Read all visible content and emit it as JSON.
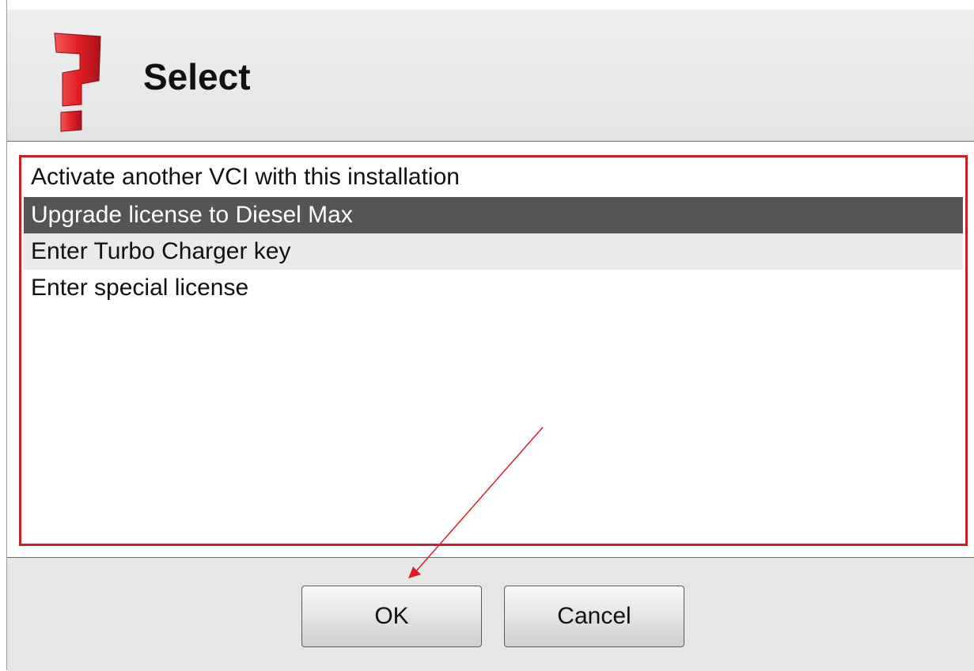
{
  "dialog": {
    "title": "Select",
    "icon": "question-mark-icon",
    "accent_color": "#c8202a"
  },
  "options": {
    "items": [
      {
        "label": "Activate another VCI with this installation",
        "state": "normal"
      },
      {
        "label": "Upgrade license to Diesel Max",
        "state": "selected"
      },
      {
        "label": "Enter Turbo Charger key",
        "state": "highlighted"
      },
      {
        "label": "Enter special license",
        "state": "normal"
      }
    ]
  },
  "buttons": {
    "ok_label": "OK",
    "cancel_label": "Cancel"
  },
  "annotation": {
    "arrow_color": "#d81f26",
    "highlight_box_color": "#c8202a"
  }
}
